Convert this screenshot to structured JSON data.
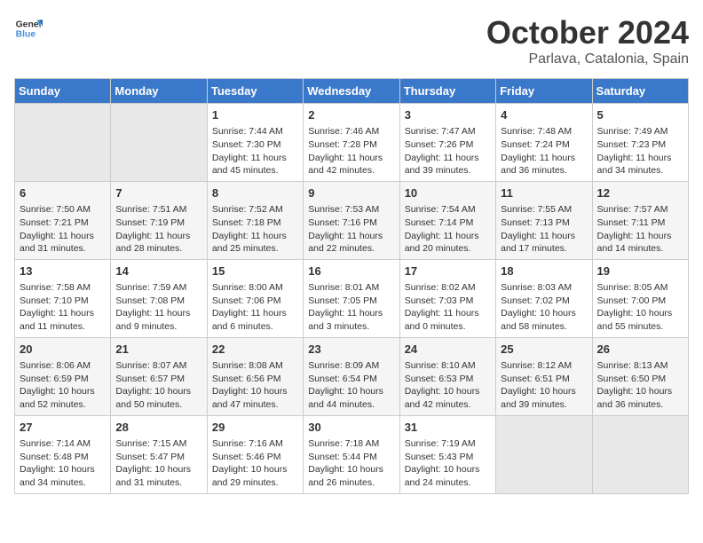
{
  "logo": {
    "line1": "General",
    "line2": "Blue"
  },
  "title": "October 2024",
  "location": "Parlava, Catalonia, Spain",
  "days_of_week": [
    "Sunday",
    "Monday",
    "Tuesday",
    "Wednesday",
    "Thursday",
    "Friday",
    "Saturday"
  ],
  "weeks": [
    [
      {
        "day": "",
        "empty": true
      },
      {
        "day": "",
        "empty": true
      },
      {
        "day": "1",
        "sunrise": "Sunrise: 7:44 AM",
        "sunset": "Sunset: 7:30 PM",
        "daylight": "Daylight: 11 hours and 45 minutes."
      },
      {
        "day": "2",
        "sunrise": "Sunrise: 7:46 AM",
        "sunset": "Sunset: 7:28 PM",
        "daylight": "Daylight: 11 hours and 42 minutes."
      },
      {
        "day": "3",
        "sunrise": "Sunrise: 7:47 AM",
        "sunset": "Sunset: 7:26 PM",
        "daylight": "Daylight: 11 hours and 39 minutes."
      },
      {
        "day": "4",
        "sunrise": "Sunrise: 7:48 AM",
        "sunset": "Sunset: 7:24 PM",
        "daylight": "Daylight: 11 hours and 36 minutes."
      },
      {
        "day": "5",
        "sunrise": "Sunrise: 7:49 AM",
        "sunset": "Sunset: 7:23 PM",
        "daylight": "Daylight: 11 hours and 34 minutes."
      }
    ],
    [
      {
        "day": "6",
        "sunrise": "Sunrise: 7:50 AM",
        "sunset": "Sunset: 7:21 PM",
        "daylight": "Daylight: 11 hours and 31 minutes."
      },
      {
        "day": "7",
        "sunrise": "Sunrise: 7:51 AM",
        "sunset": "Sunset: 7:19 PM",
        "daylight": "Daylight: 11 hours and 28 minutes."
      },
      {
        "day": "8",
        "sunrise": "Sunrise: 7:52 AM",
        "sunset": "Sunset: 7:18 PM",
        "daylight": "Daylight: 11 hours and 25 minutes."
      },
      {
        "day": "9",
        "sunrise": "Sunrise: 7:53 AM",
        "sunset": "Sunset: 7:16 PM",
        "daylight": "Daylight: 11 hours and 22 minutes."
      },
      {
        "day": "10",
        "sunrise": "Sunrise: 7:54 AM",
        "sunset": "Sunset: 7:14 PM",
        "daylight": "Daylight: 11 hours and 20 minutes."
      },
      {
        "day": "11",
        "sunrise": "Sunrise: 7:55 AM",
        "sunset": "Sunset: 7:13 PM",
        "daylight": "Daylight: 11 hours and 17 minutes."
      },
      {
        "day": "12",
        "sunrise": "Sunrise: 7:57 AM",
        "sunset": "Sunset: 7:11 PM",
        "daylight": "Daylight: 11 hours and 14 minutes."
      }
    ],
    [
      {
        "day": "13",
        "sunrise": "Sunrise: 7:58 AM",
        "sunset": "Sunset: 7:10 PM",
        "daylight": "Daylight: 11 hours and 11 minutes."
      },
      {
        "day": "14",
        "sunrise": "Sunrise: 7:59 AM",
        "sunset": "Sunset: 7:08 PM",
        "daylight": "Daylight: 11 hours and 9 minutes."
      },
      {
        "day": "15",
        "sunrise": "Sunrise: 8:00 AM",
        "sunset": "Sunset: 7:06 PM",
        "daylight": "Daylight: 11 hours and 6 minutes."
      },
      {
        "day": "16",
        "sunrise": "Sunrise: 8:01 AM",
        "sunset": "Sunset: 7:05 PM",
        "daylight": "Daylight: 11 hours and 3 minutes."
      },
      {
        "day": "17",
        "sunrise": "Sunrise: 8:02 AM",
        "sunset": "Sunset: 7:03 PM",
        "daylight": "Daylight: 11 hours and 0 minutes."
      },
      {
        "day": "18",
        "sunrise": "Sunrise: 8:03 AM",
        "sunset": "Sunset: 7:02 PM",
        "daylight": "Daylight: 10 hours and 58 minutes."
      },
      {
        "day": "19",
        "sunrise": "Sunrise: 8:05 AM",
        "sunset": "Sunset: 7:00 PM",
        "daylight": "Daylight: 10 hours and 55 minutes."
      }
    ],
    [
      {
        "day": "20",
        "sunrise": "Sunrise: 8:06 AM",
        "sunset": "Sunset: 6:59 PM",
        "daylight": "Daylight: 10 hours and 52 minutes."
      },
      {
        "day": "21",
        "sunrise": "Sunrise: 8:07 AM",
        "sunset": "Sunset: 6:57 PM",
        "daylight": "Daylight: 10 hours and 50 minutes."
      },
      {
        "day": "22",
        "sunrise": "Sunrise: 8:08 AM",
        "sunset": "Sunset: 6:56 PM",
        "daylight": "Daylight: 10 hours and 47 minutes."
      },
      {
        "day": "23",
        "sunrise": "Sunrise: 8:09 AM",
        "sunset": "Sunset: 6:54 PM",
        "daylight": "Daylight: 10 hours and 44 minutes."
      },
      {
        "day": "24",
        "sunrise": "Sunrise: 8:10 AM",
        "sunset": "Sunset: 6:53 PM",
        "daylight": "Daylight: 10 hours and 42 minutes."
      },
      {
        "day": "25",
        "sunrise": "Sunrise: 8:12 AM",
        "sunset": "Sunset: 6:51 PM",
        "daylight": "Daylight: 10 hours and 39 minutes."
      },
      {
        "day": "26",
        "sunrise": "Sunrise: 8:13 AM",
        "sunset": "Sunset: 6:50 PM",
        "daylight": "Daylight: 10 hours and 36 minutes."
      }
    ],
    [
      {
        "day": "27",
        "sunrise": "Sunrise: 7:14 AM",
        "sunset": "Sunset: 5:48 PM",
        "daylight": "Daylight: 10 hours and 34 minutes."
      },
      {
        "day": "28",
        "sunrise": "Sunrise: 7:15 AM",
        "sunset": "Sunset: 5:47 PM",
        "daylight": "Daylight: 10 hours and 31 minutes."
      },
      {
        "day": "29",
        "sunrise": "Sunrise: 7:16 AM",
        "sunset": "Sunset: 5:46 PM",
        "daylight": "Daylight: 10 hours and 29 minutes."
      },
      {
        "day": "30",
        "sunrise": "Sunrise: 7:18 AM",
        "sunset": "Sunset: 5:44 PM",
        "daylight": "Daylight: 10 hours and 26 minutes."
      },
      {
        "day": "31",
        "sunrise": "Sunrise: 7:19 AM",
        "sunset": "Sunset: 5:43 PM",
        "daylight": "Daylight: 10 hours and 24 minutes."
      },
      {
        "day": "",
        "empty": true
      },
      {
        "day": "",
        "empty": true
      }
    ]
  ]
}
